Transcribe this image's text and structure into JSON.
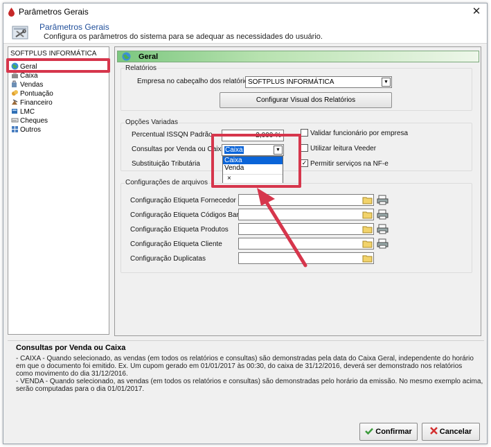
{
  "window": {
    "title": "Parâmetros Gerais",
    "close_glyph": "✕"
  },
  "header": {
    "title": "Parâmetros Gerais",
    "subtitle": "Configura os parâmetros do sistema para se adequar as necessidades do usuário."
  },
  "sidebar": {
    "root": "SOFTPLUS INFORMÁTICA",
    "items": [
      {
        "label": "Geral",
        "icon": "globe-icon"
      },
      {
        "label": "Caixa",
        "icon": "cash-register-icon"
      },
      {
        "label": "Vendas",
        "icon": "shopping-icon"
      },
      {
        "label": "Pontuação",
        "icon": "points-icon"
      },
      {
        "label": "Financeiro",
        "icon": "finance-icon"
      },
      {
        "label": "LMC",
        "icon": "fuel-icon"
      },
      {
        "label": "Cheques",
        "icon": "check-icon"
      },
      {
        "label": "Outros",
        "icon": "others-icon"
      }
    ]
  },
  "content": {
    "heading": "Geral",
    "relatorios": {
      "group_label": "Relatórios",
      "empresa_label": "Empresa no cabeçalho dos relatórios",
      "empresa_value": "SOFTPLUS INFORMÁTICA",
      "config_button": "Configurar Visual dos Relatórios"
    },
    "opcoes": {
      "group_label": "Opções Variadas",
      "issqn_label": "Percentual ISSQN Padrão",
      "issqn_value": "2,000 %",
      "consultas_label": "Consultas por Venda ou Caixa",
      "consultas_value": "Caixa",
      "consultas_options": [
        "Caixa",
        "Venda"
      ],
      "popup_close": "×",
      "substituicao_label": "Substituição Tributária",
      "validar_label": "Validar funcionário por empresa",
      "veeder_label": "Utilizar leitura Veeder",
      "nfe_label": "Permitir serviços na NF-e"
    },
    "arquivos": {
      "group_label": "Configurações de arquivos",
      "rows": [
        "Configuração Etiqueta Fornecedor",
        "Configuração Etiqueta Códigos Barras",
        "Configuração Etiqueta Produtos",
        "Configuração Etiqueta Cliente",
        "Configuração Duplicatas"
      ]
    }
  },
  "help": {
    "title": "Consultas por Venda ou Caixa",
    "lines": [
      "- CAIXA - Quando selecionado, as vendas (em todos os relatórios e consultas) são demonstradas pela data do Caixa Geral, independente do horário",
      "em que o documento foi emitido. Ex. Um cupom gerado em 01/01/2017 às 00:30, do caixa de 31/12/2016, deverá ser demonstrado nos relatórios",
      "como movimento do dia 31/12/2016.",
      "- VENDA - Quando selecionado, as vendas (em todos os relatórios e consultas) são demonstradas pelo horário da emissão. No mesmo exemplo acima,",
      "serão computadas para o dia 01/01/2017."
    ]
  },
  "footer": {
    "confirm": "Confirmar",
    "cancel": "Cancelar"
  },
  "colors": {
    "highlight": "#d6364c",
    "selection": "#0a64d8",
    "header_green": "#7cc77f"
  }
}
